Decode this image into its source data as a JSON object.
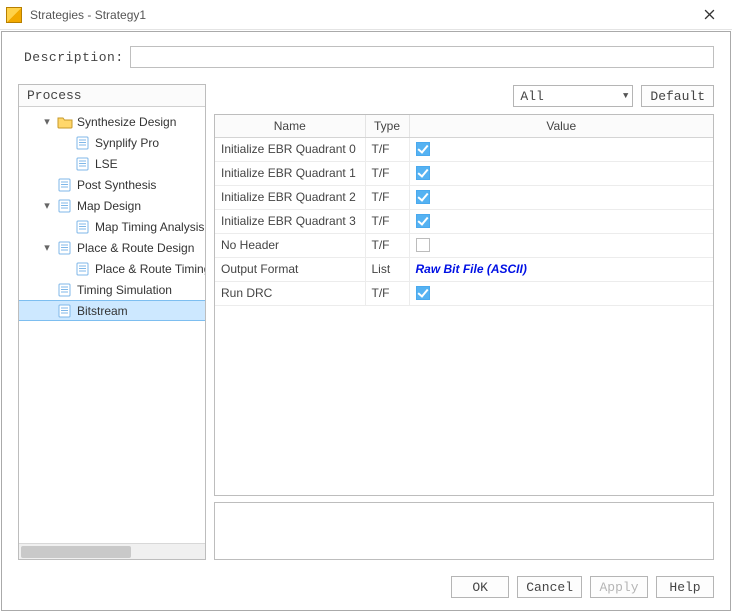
{
  "window": {
    "title": "Strategies - Strategy1"
  },
  "description": {
    "label": "Description:",
    "value": ""
  },
  "process": {
    "header": "Process",
    "tree": [
      {
        "label": "Synthesize Design",
        "level": 1,
        "icon": "folder",
        "twisty": "▾"
      },
      {
        "label": "Synplify Pro",
        "level": 2,
        "icon": "page",
        "twisty": ""
      },
      {
        "label": "LSE",
        "level": 2,
        "icon": "page",
        "twisty": ""
      },
      {
        "label": "Post Synthesis",
        "level": 1,
        "icon": "page",
        "twisty": ""
      },
      {
        "label": "Map Design",
        "level": 1,
        "icon": "page",
        "twisty": "▾"
      },
      {
        "label": "Map Timing Analysis",
        "level": 2,
        "icon": "page",
        "twisty": ""
      },
      {
        "label": "Place & Route Design",
        "level": 1,
        "icon": "page",
        "twisty": "▾"
      },
      {
        "label": "Place & Route Timing",
        "level": 2,
        "icon": "page",
        "twisty": ""
      },
      {
        "label": "Timing Simulation",
        "level": 1,
        "icon": "page",
        "twisty": ""
      },
      {
        "label": "Bitstream",
        "level": 1,
        "icon": "page",
        "twisty": "",
        "selected": true
      }
    ]
  },
  "filter": {
    "value": "All",
    "default_btn": "Default"
  },
  "grid": {
    "columns": {
      "name": "Name",
      "type": "Type",
      "value": "Value"
    },
    "rows": [
      {
        "name": "Initialize EBR Quadrant 0",
        "type": "T/F",
        "checked": true
      },
      {
        "name": "Initialize EBR Quadrant 1",
        "type": "T/F",
        "checked": true
      },
      {
        "name": "Initialize EBR Quadrant 2",
        "type": "T/F",
        "checked": true
      },
      {
        "name": "Initialize EBR Quadrant 3",
        "type": "T/F",
        "checked": true
      },
      {
        "name": "No Header",
        "type": "T/F",
        "checked": false
      },
      {
        "name": "Output Format",
        "type": "List",
        "text": "Raw Bit File (ASCII)",
        "link": true
      },
      {
        "name": "Run DRC",
        "type": "T/F",
        "checked": true
      }
    ]
  },
  "footer": {
    "ok": "OK",
    "cancel": "Cancel",
    "apply": "Apply",
    "help": "Help"
  }
}
